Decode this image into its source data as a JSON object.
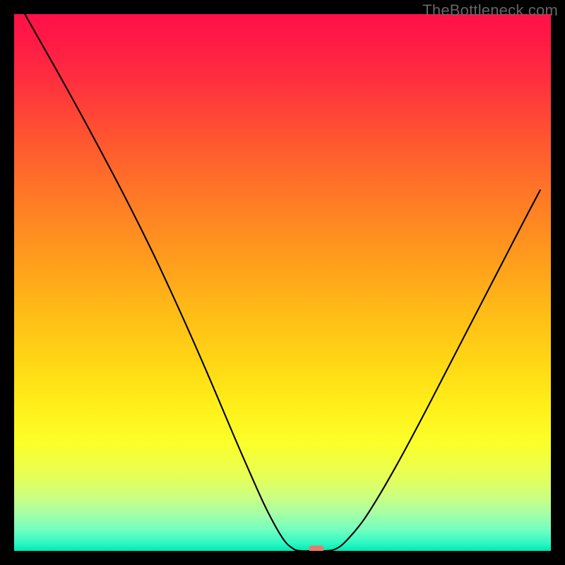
{
  "watermark": "TheBottleneck.com",
  "chart_data": {
    "type": "line",
    "title": "",
    "xlabel": "",
    "ylabel": "",
    "xlim": [
      0,
      100
    ],
    "ylim": [
      0,
      100
    ],
    "grid": false,
    "legend": false,
    "background": {
      "type": "vertical-gradient",
      "stops": [
        {
          "offset": 0,
          "color": "#ff1148"
        },
        {
          "offset": 0.05,
          "color": "#ff1a45"
        },
        {
          "offset": 0.12,
          "color": "#ff2e3f"
        },
        {
          "offset": 0.22,
          "color": "#ff5132"
        },
        {
          "offset": 0.34,
          "color": "#ff7926"
        },
        {
          "offset": 0.45,
          "color": "#ff9a1d"
        },
        {
          "offset": 0.55,
          "color": "#ffba17"
        },
        {
          "offset": 0.65,
          "color": "#ffd714"
        },
        {
          "offset": 0.73,
          "color": "#ffef1a"
        },
        {
          "offset": 0.8,
          "color": "#fbff2a"
        },
        {
          "offset": 0.86,
          "color": "#e7ff55"
        },
        {
          "offset": 0.9,
          "color": "#caff82"
        },
        {
          "offset": 0.93,
          "color": "#a6ffa6"
        },
        {
          "offset": 0.96,
          "color": "#73ffbf"
        },
        {
          "offset": 0.985,
          "color": "#30f8c4"
        },
        {
          "offset": 1.0,
          "color": "#00e9b0"
        }
      ]
    },
    "series": [
      {
        "name": "curve",
        "color": "#000000",
        "width": 2.1,
        "x": [
          2,
          5,
          8,
          11,
          14,
          17,
          20,
          23,
          26,
          29,
          32,
          35,
          38,
          41,
          44,
          47,
          50,
          52,
          53.5,
          55,
          58,
          60,
          62,
          65,
          68,
          71,
          74,
          77,
          80,
          83,
          86,
          89,
          92,
          95,
          98
        ],
        "y": [
          100,
          94.7,
          89.4,
          84.0,
          78.5,
          72.9,
          67.2,
          61.3,
          55.2,
          48.8,
          42.2,
          35.4,
          28.4,
          21.3,
          14.4,
          7.8,
          2.4,
          0.4,
          0.0,
          0.0,
          0.0,
          0.4,
          2.0,
          5.6,
          10.3,
          15.5,
          21.0,
          26.7,
          32.5,
          38.3,
          44.1,
          49.9,
          55.7,
          61.5,
          67.2
        ]
      }
    ],
    "marker": {
      "shape": "rounded-rect",
      "x": 56.3,
      "y": 0.4,
      "w": 2.8,
      "h": 1.2,
      "color": "#e77b6f"
    }
  }
}
